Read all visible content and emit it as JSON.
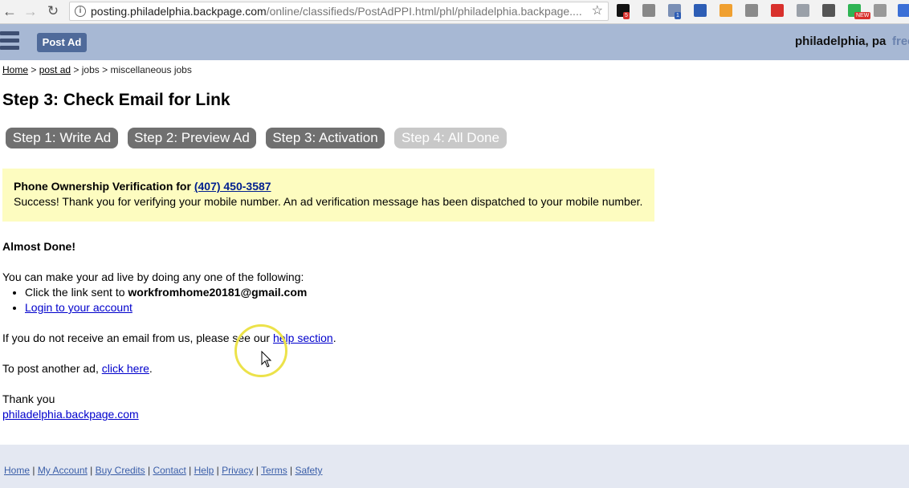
{
  "browser": {
    "url_host": "posting.philadelphia.backpage.com",
    "url_path": "/online/classifieds/PostAdPPI.html/phl/philadelphia.backpage....",
    "extensions": [
      {
        "name": "amazon-icon",
        "color": "#111111",
        "badge": "5"
      },
      {
        "name": "gray-circle-icon",
        "color": "#888888"
      },
      {
        "name": "phone-icon",
        "color": "#7a8fb5",
        "badge": "1"
      },
      {
        "name": "bookmark-icon",
        "color": "#2d5db5"
      },
      {
        "name": "orange-ext-icon",
        "color": "#f0a030"
      },
      {
        "name": "code-icon",
        "color": "#8a8a8a"
      },
      {
        "name": "red-dots-icon",
        "color": "#d8302c"
      },
      {
        "name": "dropbox-icon",
        "color": "#9aa0a8"
      },
      {
        "name": "evernote-icon",
        "color": "#555555"
      },
      {
        "name": "green-circle-icon",
        "color": "#2fb454",
        "badge": "NEW"
      },
      {
        "name": "gray-square-icon",
        "color": "#999999"
      },
      {
        "name": "blue-puzzle-icon",
        "color": "#3b6fd6"
      }
    ]
  },
  "header": {
    "post_ad": "Post Ad",
    "city": "philadelphia, pa",
    "free": "free"
  },
  "breadcrumb": {
    "home": "Home",
    "sep1": " > ",
    "post_ad": "post ad",
    "sep2": " > jobs > miscellaneous jobs"
  },
  "page_title": "Step 3: Check Email for Link",
  "steps": [
    {
      "label": "Step 1: Write Ad",
      "state": "done"
    },
    {
      "label": "Step 2: Preview Ad",
      "state": "done"
    },
    {
      "label": "Step 3: Activation",
      "state": "current"
    },
    {
      "label": "Step 4: All Done",
      "state": "disabled"
    }
  ],
  "notice": {
    "heading": "Phone Ownership Verification for ",
    "phone": "(407) 450-3587",
    "message": "Success! Thank you for verifying your mobile number. An ad verification message has been dispatched to your mobile number."
  },
  "content": {
    "almost_done": "Almost Done!",
    "intro": "You can make your ad live by doing any one of the following:",
    "item1_prefix": "Click the link sent to ",
    "item1_email": "workfromhome20181@gmail.com",
    "item2_link": "Login to your account",
    "help_prefix": "If you do not receive an email from us, please see our ",
    "help_link": "help section",
    "help_suffix": ".",
    "post_prefix": "To post another ad, ",
    "post_link": "click here",
    "post_suffix": ".",
    "thanks": "Thank you",
    "site_link": "philadelphia.backpage.com"
  },
  "footer": {
    "links": [
      "Home",
      "My Account",
      "Buy Credits",
      "Contact",
      "Help",
      "Privacy",
      "Terms",
      "Safety"
    ]
  }
}
